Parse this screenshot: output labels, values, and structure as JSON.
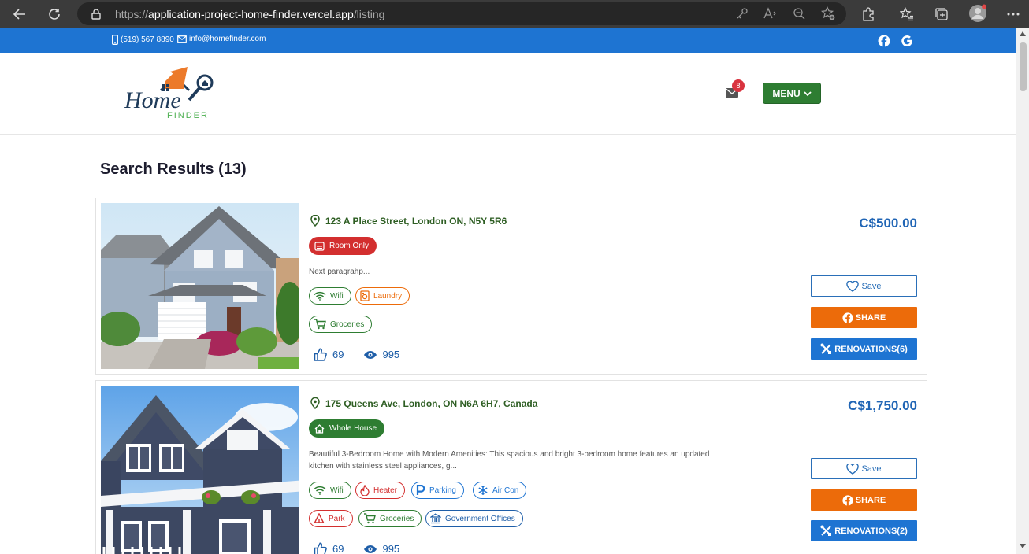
{
  "browser": {
    "url_prefix": "https://",
    "url_host": "application-project-home-finder.vercel.app",
    "url_path": "/listing"
  },
  "topbar": {
    "phone": "(519) 567 8890",
    "email": "info@homefinder.com"
  },
  "header": {
    "logo_home": "Home",
    "logo_finder": "FINDER",
    "mail_count": "8",
    "menu_label": "MENU"
  },
  "results": {
    "title": "Search Results (13)"
  },
  "listings": [
    {
      "address": "123 A Place Street, London ON, N5Y 5R6",
      "type": "Room Only",
      "type_color": "#d32f2f",
      "description": "Next paragrahp...",
      "amenities_row1": [
        {
          "label": "Wifi",
          "icon": "wifi-icon",
          "color": "#2e7d32"
        },
        {
          "label": "Laundry",
          "icon": "laundry-icon",
          "color": "#ec6b0a"
        }
      ],
      "amenities_row2": [
        {
          "label": "Groceries",
          "icon": "cart-icon",
          "color": "#2e7d32"
        }
      ],
      "likes": "69",
      "views": "995",
      "price": "C$500.00",
      "save_label": "Save",
      "share_label": "SHARE",
      "renovations_label": "RENOVATIONS(6)"
    },
    {
      "address": "175 Queens Ave, London, ON N6A 6H7, Canada",
      "type": "Whole House",
      "type_color": "#2e7d32",
      "description": "Beautiful 3-Bedroom Home with Modern Amenities: This spacious and bright 3-bedroom home features an updated kitchen with stainless steel appliances, g...",
      "amenities_row1": [
        {
          "label": "Wifi",
          "icon": "wifi-icon",
          "color": "#2e7d32"
        },
        {
          "label": "Heater",
          "icon": "flame-icon",
          "color": "#d32f2f"
        },
        {
          "label": "Parking",
          "icon": "parking-icon",
          "color": "#1e74d2"
        },
        {
          "label": "Air Con",
          "icon": "snowflake-icon",
          "color": "#1e74d2"
        }
      ],
      "amenities_row2": [
        {
          "label": "Park",
          "icon": "park-icon",
          "color": "#d32f2f"
        },
        {
          "label": "Groceries",
          "icon": "cart-icon",
          "color": "#2e7d32"
        },
        {
          "label": "Government Offices",
          "icon": "government-icon",
          "color": "#1e5ea8"
        }
      ],
      "likes": "69",
      "views": "995",
      "price": "C$1,750.00",
      "save_label": "Save",
      "share_label": "SHARE",
      "renovations_label": "RENOVATIONS(2)"
    }
  ]
}
